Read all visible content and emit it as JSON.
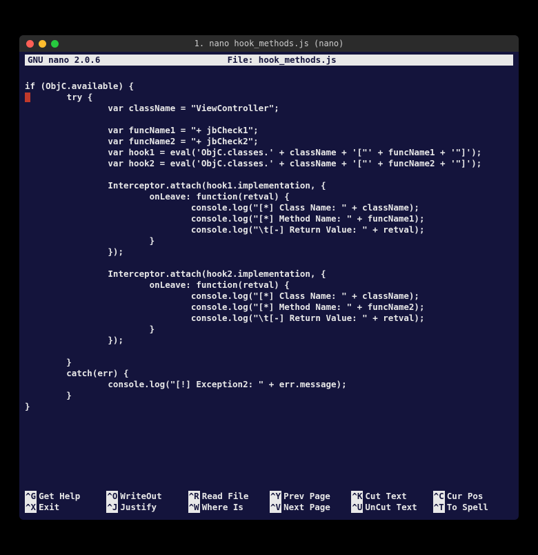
{
  "window": {
    "title": "1. nano hook_methods.js (nano)"
  },
  "statusbar": {
    "app": "GNU nano 2.0.6",
    "file_label": "File: hook_methods.js"
  },
  "code_lines": [
    "",
    "if (ObjC.available) {",
    "        try {",
    "                var className = \"ViewController\";",
    "",
    "                var funcName1 = \"+ jbCheck1\";",
    "                var funcName2 = \"+ jbCheck2\";",
    "                var hook1 = eval('ObjC.classes.' + className + '[\"' + funcName1 + '\"]');",
    "                var hook2 = eval('ObjC.classes.' + className + '[\"' + funcName2 + '\"]');",
    "",
    "                Interceptor.attach(hook1.implementation, {",
    "                        onLeave: function(retval) {",
    "                                console.log(\"[*] Class Name: \" + className);",
    "                                console.log(\"[*] Method Name: \" + funcName1);",
    "                                console.log(\"\\t[-] Return Value: \" + retval);",
    "                        }",
    "                });",
    "",
    "                Interceptor.attach(hook2.implementation, {",
    "                        onLeave: function(retval) {",
    "                                console.log(\"[*] Class Name: \" + className);",
    "                                console.log(\"[*] Method Name: \" + funcName2);",
    "                                console.log(\"\\t[-] Return Value: \" + retval);",
    "                        }",
    "                });",
    "",
    "        }",
    "        catch(err) {",
    "                console.log(\"[!] Exception2: \" + err.message);",
    "        }",
    "}",
    ""
  ],
  "cursor_line_index": 2,
  "shortcuts": {
    "row1": [
      {
        "key": "^G",
        "label": "Get Help"
      },
      {
        "key": "^O",
        "label": "WriteOut"
      },
      {
        "key": "^R",
        "label": "Read File"
      },
      {
        "key": "^Y",
        "label": "Prev Page"
      },
      {
        "key": "^K",
        "label": "Cut Text"
      },
      {
        "key": "^C",
        "label": "Cur Pos"
      }
    ],
    "row2": [
      {
        "key": "^X",
        "label": "Exit"
      },
      {
        "key": "^J",
        "label": "Justify"
      },
      {
        "key": "^W",
        "label": "Where Is"
      },
      {
        "key": "^V",
        "label": "Next Page"
      },
      {
        "key": "^U",
        "label": "UnCut Text"
      },
      {
        "key": "^T",
        "label": "To Spell"
      }
    ]
  }
}
